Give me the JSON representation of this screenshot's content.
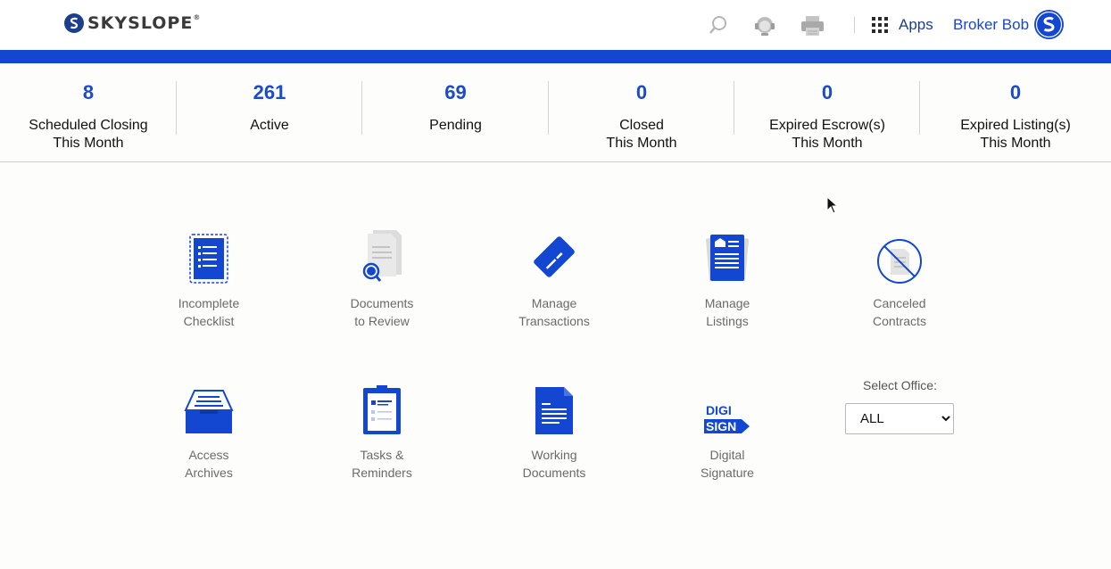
{
  "header": {
    "logo_text": "SKYSLOPE",
    "logo_tm": "®",
    "apps_label": "Apps",
    "user_name": "Broker Bob",
    "icons": [
      "search-icon",
      "support-agent-icon",
      "print-icon",
      "apps-grid-icon",
      "user-avatar-icon"
    ]
  },
  "colors": {
    "brand_blue": "#1347d2",
    "stat_blue": "#1b4bc8",
    "label_gray": "#6a6a6a"
  },
  "stats": [
    {
      "value": "8",
      "label_line1": "Scheduled Closing",
      "label_line2": "This Month"
    },
    {
      "value": "261",
      "label_line1": "Active",
      "label_line2": ""
    },
    {
      "value": "69",
      "label_line1": "Pending",
      "label_line2": ""
    },
    {
      "value": "0",
      "label_line1": "Closed",
      "label_line2": "This Month"
    },
    {
      "value": "0",
      "label_line1": "Expired Escrow(s)",
      "label_line2": "This Month"
    },
    {
      "value": "0",
      "label_line1": "Expired Listing(s)",
      "label_line2": "This Month"
    }
  ],
  "tiles": [
    {
      "line1": "Incomplete",
      "line2": "Checklist",
      "icon": "checklist-icon"
    },
    {
      "line1": "Documents",
      "line2": "to Review",
      "icon": "document-review-icon"
    },
    {
      "line1": "Manage",
      "line2": "Transactions",
      "icon": "transaction-card-icon"
    },
    {
      "line1": "Manage",
      "line2": "Listings",
      "icon": "listing-icon"
    },
    {
      "line1": "Canceled",
      "line2": "Contracts",
      "icon": "canceled-document-icon"
    },
    {
      "line1": "Access",
      "line2": "Archives",
      "icon": "archive-tray-icon"
    },
    {
      "line1": "Tasks &",
      "line2": "Reminders",
      "icon": "clipboard-icon"
    },
    {
      "line1": "Working",
      "line2": "Documents",
      "icon": "working-document-icon"
    },
    {
      "line1": "Digital",
      "line2": "Signature",
      "icon": "digisign-icon"
    }
  ],
  "digisign": {
    "top": "DIGI",
    "bottom": "SIGN"
  },
  "office": {
    "label": "Select Office:",
    "selected": "ALL"
  }
}
